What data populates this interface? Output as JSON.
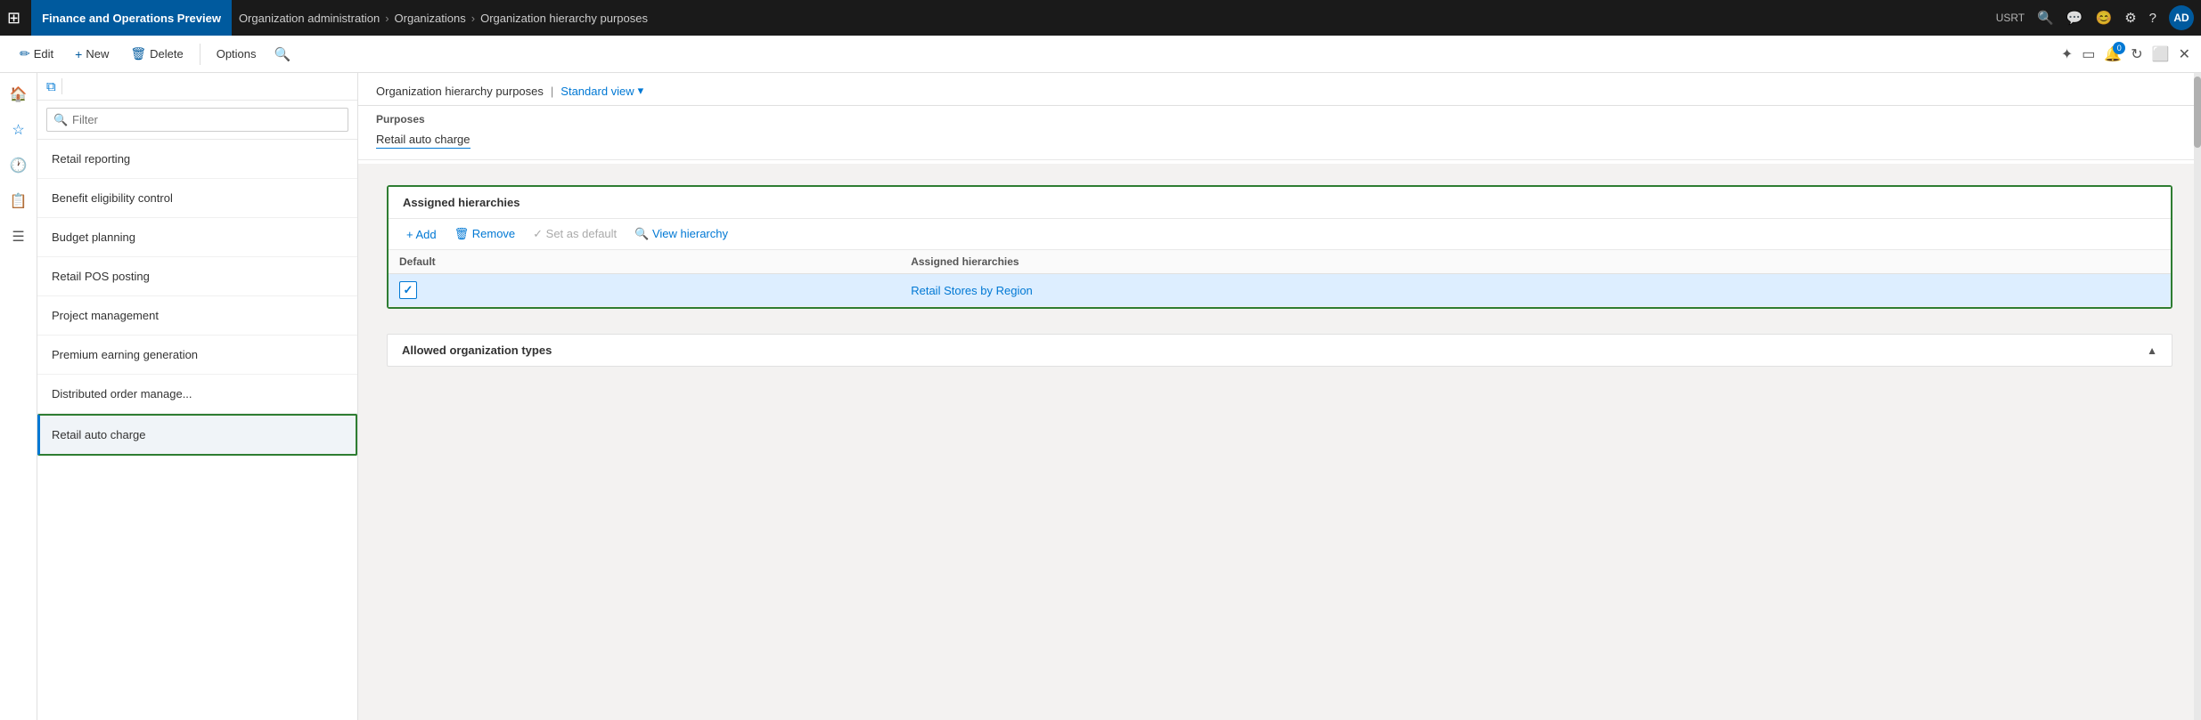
{
  "topnav": {
    "app_title": "Finance and Operations Preview",
    "breadcrumb": [
      "Organization administration",
      "Organizations",
      "Organization hierarchy purposes"
    ],
    "usrt_label": "USRT",
    "avatar_label": "AD"
  },
  "toolbar": {
    "edit_label": "Edit",
    "new_label": "New",
    "delete_label": "Delete",
    "options_label": "Options"
  },
  "filter": {
    "placeholder": "Filter"
  },
  "list_items": [
    {
      "label": "Retail reporting",
      "active": false
    },
    {
      "label": "Benefit eligibility control",
      "active": false
    },
    {
      "label": "Budget planning",
      "active": false
    },
    {
      "label": "Retail POS posting",
      "active": false
    },
    {
      "label": "Project management",
      "active": false
    },
    {
      "label": "Premium earning generation",
      "active": false
    },
    {
      "label": "Distributed order manage...",
      "active": false
    },
    {
      "label": "Retail auto charge",
      "active": true
    }
  ],
  "detail": {
    "page_title": "Organization hierarchy purposes",
    "view_label": "Standard view",
    "purposes_label": "Purposes",
    "field_value": "Retail auto charge",
    "assigned_hierarchies_label": "Assigned hierarchies",
    "toolbar_add": "+ Add",
    "toolbar_remove": "🗑 Remove",
    "toolbar_set_default": "✓ Set as default",
    "toolbar_view_hierarchy": "🔍 View hierarchy",
    "table_col_default": "Default",
    "table_col_assigned": "Assigned hierarchies",
    "table_rows": [
      {
        "is_default": true,
        "hierarchy": "Retail Stores by Region"
      }
    ],
    "allowed_org_label": "Allowed organization types"
  }
}
